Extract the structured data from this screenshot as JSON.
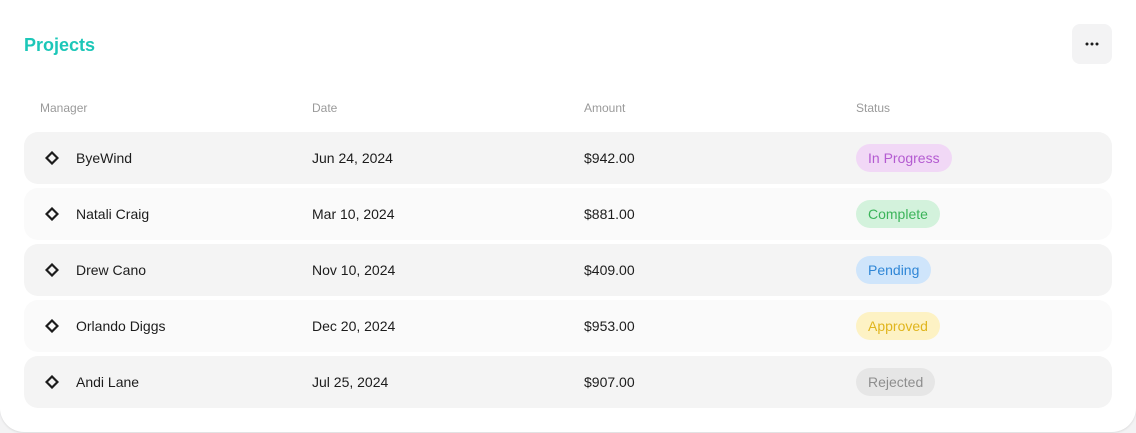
{
  "card": {
    "title": "Projects",
    "more_icon": "more-horizontal-icon"
  },
  "table": {
    "headers": [
      "Manager",
      "Date",
      "Amount",
      "Status"
    ],
    "rows": [
      {
        "manager": "ByeWind",
        "date": "Jun 24, 2024",
        "amount": "$942.00",
        "status": "In Progress"
      },
      {
        "manager": "Natali Craig",
        "date": "Mar 10, 2024",
        "amount": "$881.00",
        "status": "Complete"
      },
      {
        "manager": "Drew Cano",
        "date": "Nov 10, 2024",
        "amount": "$409.00",
        "status": "Pending"
      },
      {
        "manager": "Orlando Diggs",
        "date": "Dec 20, 2024",
        "amount": "$953.00",
        "status": "Approved"
      },
      {
        "manager": "Andi Lane",
        "date": "Jul 25, 2024",
        "amount": "$907.00",
        "status": "Rejected"
      }
    ]
  },
  "status_colors": {
    "In Progress": {
      "bg": "#f1d8f6",
      "fg": "#b45bd1"
    },
    "Complete": {
      "bg": "#d3f2dc",
      "fg": "#3cb45a"
    },
    "Pending": {
      "bg": "#cfe5fb",
      "fg": "#2f86d6"
    },
    "Approved": {
      "bg": "#fdf2c4",
      "fg": "#e0b51d"
    },
    "Rejected": {
      "bg": "#e6e6e6",
      "fg": "#8e8e8e"
    }
  },
  "accent_color": "#1cc7b8",
  "manager_icon": "diamond-logo-icon"
}
